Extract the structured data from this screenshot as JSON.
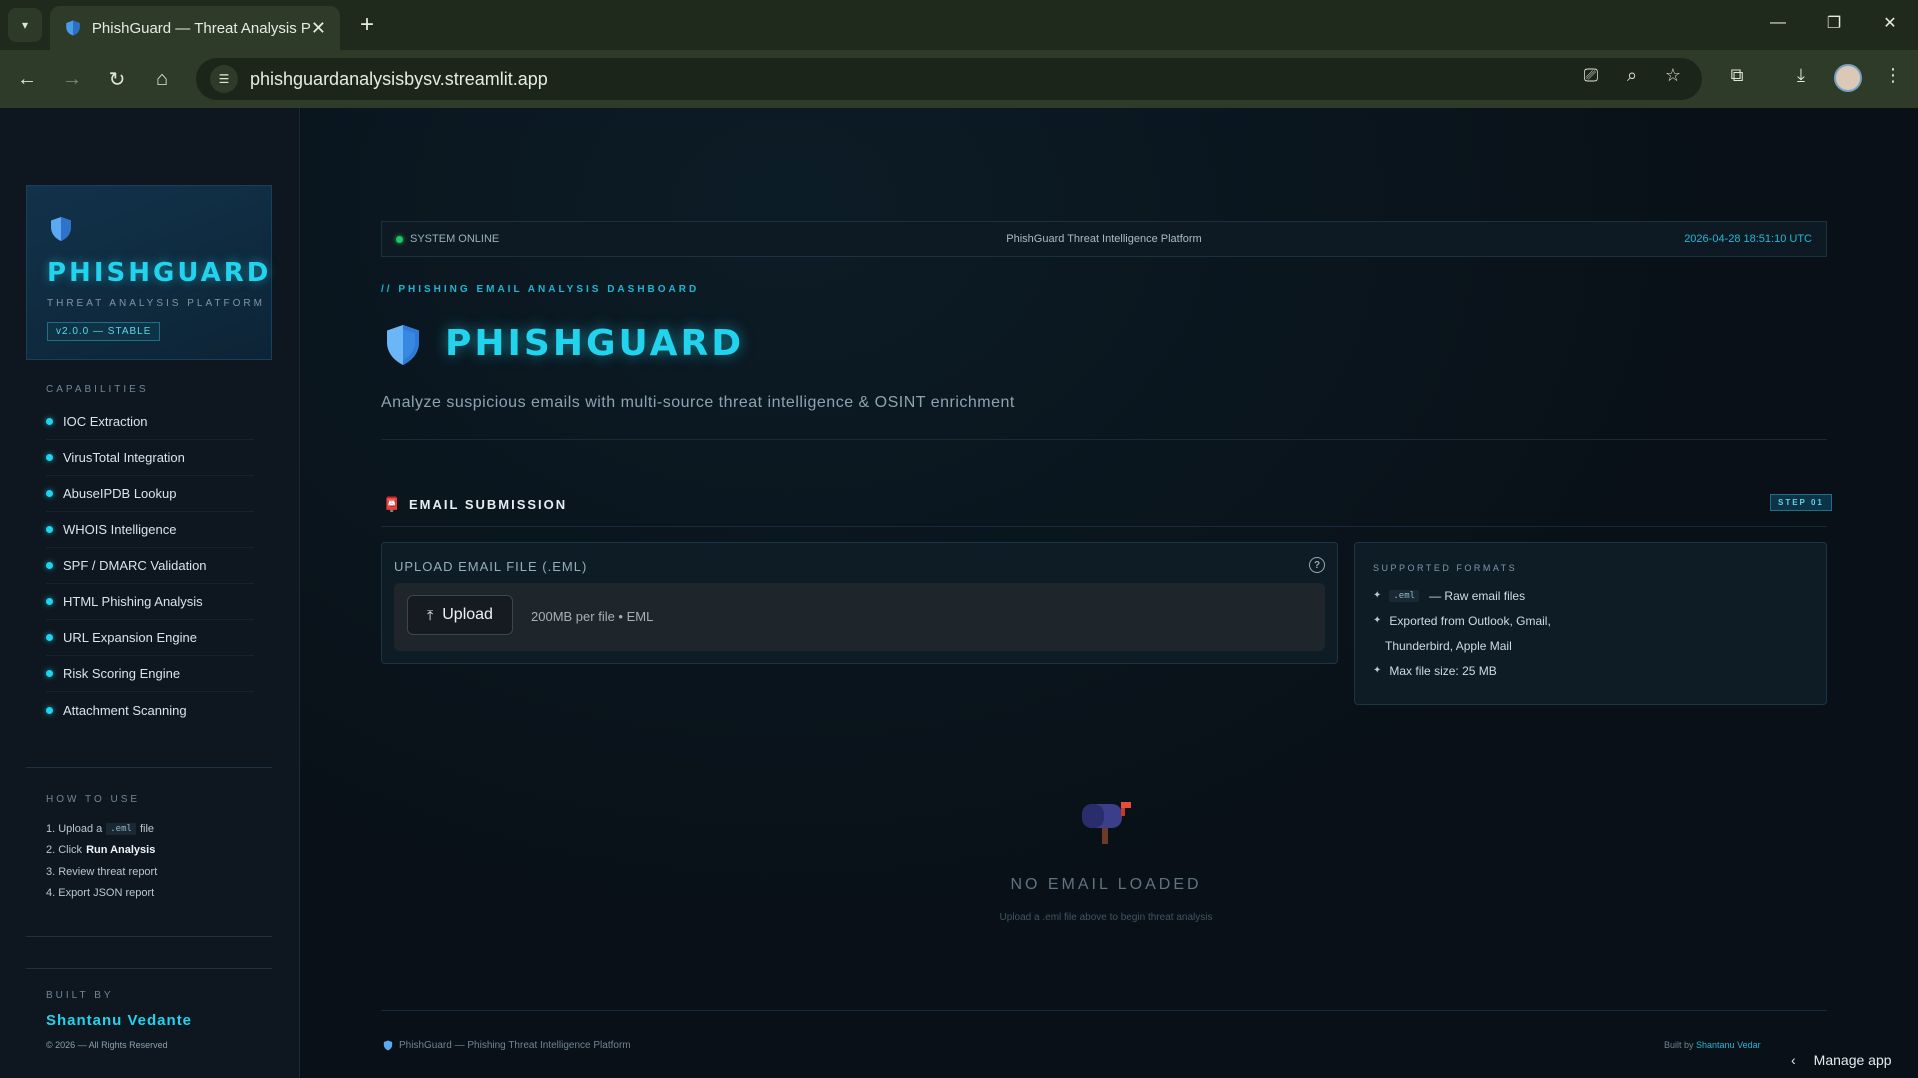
{
  "browser": {
    "tab_title": "PhishGuard — Threat Analysis Platform",
    "url": "phishguardanalysisbysv.streamlit.app",
    "new_tab_icon": "+",
    "close_icon": "✕"
  },
  "sidebar": {
    "brand_name": "PHISHGUARD",
    "brand_sub": "THREAT ANALYSIS PLATFORM",
    "version": "v2.0.0 — STABLE",
    "capabilities_title": "CAPABILITIES",
    "capabilities": [
      "IOC Extraction",
      "VirusTotal Integration",
      "AbuseIPDB Lookup",
      "WHOIS Intelligence",
      "SPF / DMARC Validation",
      "HTML Phishing Analysis",
      "URL Expansion Engine",
      "Risk Scoring Engine",
      "Attachment Scanning"
    ],
    "howto_title": "HOW TO USE",
    "howto": {
      "s1_pre": "1. Upload a",
      "s1_code": ".eml",
      "s1_post": "file",
      "s2_pre": "2. Click",
      "s2_bold": "Run Analysis",
      "s3": "3. Review threat report",
      "s4": "4. Export JSON report"
    },
    "builtby_title": "BUILT BY",
    "builtby_name": "Shantanu Vedante",
    "copyright": "© 2026 — All Rights Reserved"
  },
  "status": {
    "left": "SYSTEM ONLINE",
    "center": "PhishGuard Threat Intelligence Platform",
    "right": "2026-04-28 18:51:10 UTC"
  },
  "hero": {
    "eyebrow": "// PHISHING EMAIL ANALYSIS DASHBOARD",
    "title": "PHISHGUARD",
    "subtitle": "Analyze suspicious emails with multi-source threat intelligence & OSINT enrichment"
  },
  "submission": {
    "section_title": "EMAIL SUBMISSION",
    "step_badge": "STEP 01",
    "upload_label": "UPLOAD EMAIL FILE (.EML)",
    "upload_button": "Upload",
    "upload_hint": "200MB per file • EML",
    "formats_title": "SUPPORTED FORMATS",
    "fmt1_code": ".eml",
    "fmt1_text": "— Raw email files",
    "fmt2": "Exported from Outlook, Gmail,",
    "fmt2b": "Thunderbird, Apple Mail",
    "fmt3": "Max file size: 25 MB"
  },
  "empty": {
    "title": "NO EMAIL LOADED",
    "subtitle": "Upload a .eml file above to begin threat analysis"
  },
  "footer": {
    "left": "PhishGuard — Phishing Threat Intelligence Platform",
    "right_pre": "Built by",
    "right_name": "Shantanu Vedar",
    "manage": "Manage app"
  },
  "colors": {
    "accent": "#22d3ee",
    "online": "#22c55e",
    "background": "#0a1118"
  }
}
